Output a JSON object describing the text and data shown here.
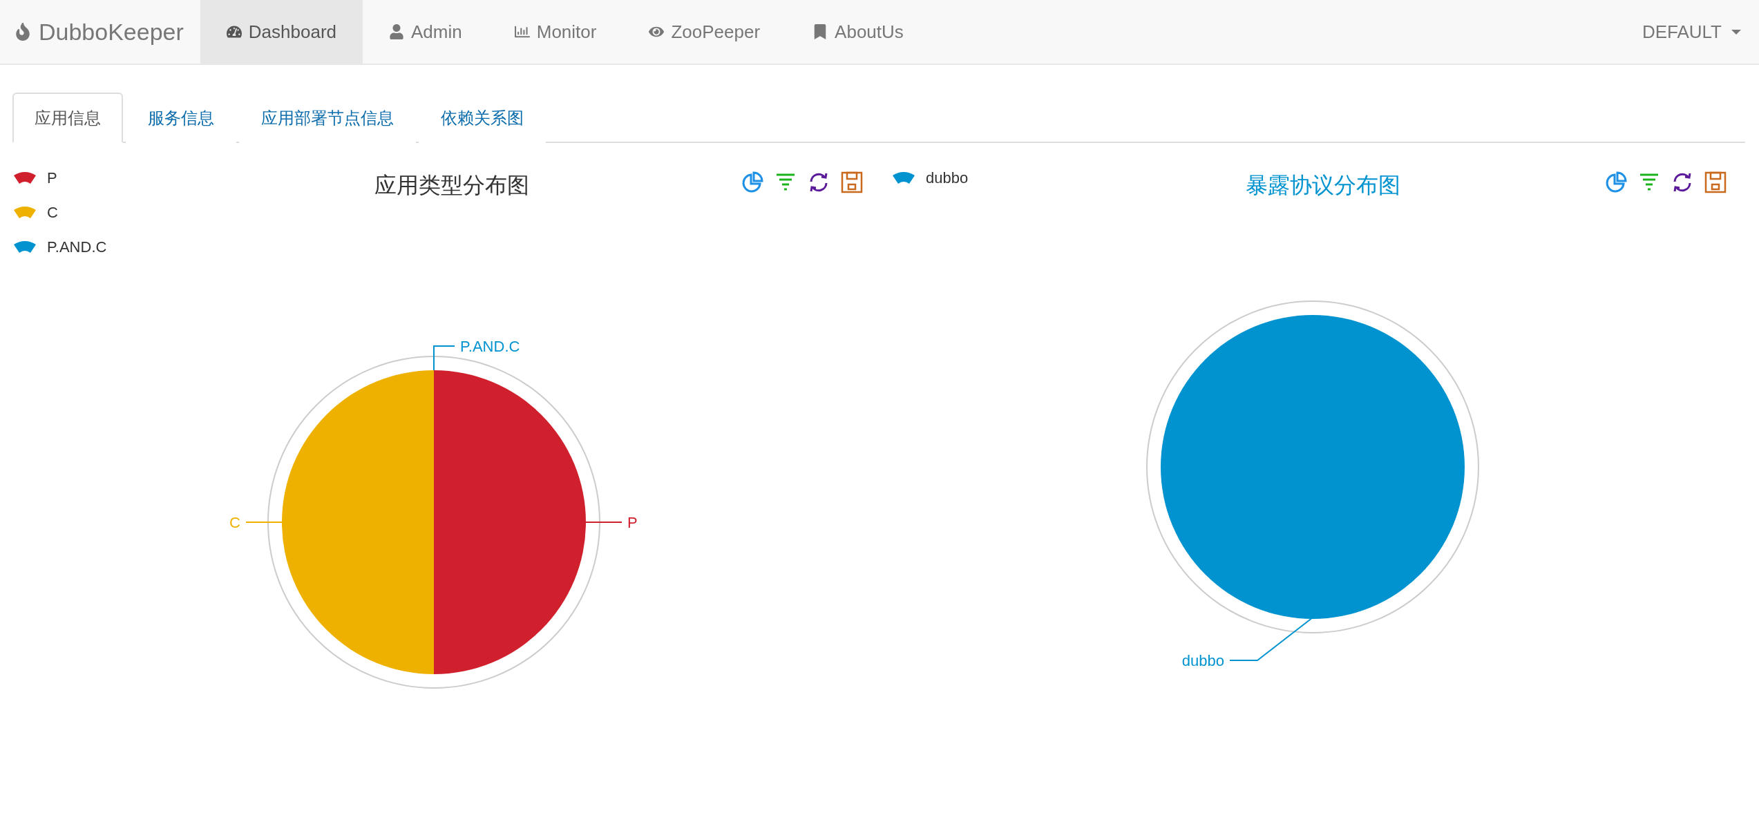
{
  "navbar": {
    "brand": "DubboKeeper",
    "items": [
      {
        "label": "Dashboard",
        "selected": true
      },
      {
        "label": "Admin",
        "selected": false
      },
      {
        "label": "Monitor",
        "selected": false
      },
      {
        "label": "ZooPeeper",
        "selected": false
      },
      {
        "label": "AboutUs",
        "selected": false
      }
    ],
    "dropdown": "DEFAULT"
  },
  "tabs": [
    {
      "label": "应用信息",
      "selected": true
    },
    {
      "label": "服务信息",
      "selected": false
    },
    {
      "label": "应用部署节点信息",
      "selected": false
    },
    {
      "label": "依赖关系图",
      "selected": false
    }
  ],
  "panels": [
    {
      "title_highlighted": false,
      "chart_data": {
        "type": "pie",
        "title": "应用类型分布图",
        "categories": [
          "P",
          "C",
          "P.AND.C"
        ],
        "values": [
          50,
          50,
          0
        ],
        "colors": [
          "#d0202e",
          "#efb100",
          "#0093d0"
        ]
      }
    },
    {
      "title_highlighted": true,
      "chart_data": {
        "type": "pie",
        "title": "暴露协议分布图",
        "categories": [
          "dubbo"
        ],
        "values": [
          100
        ],
        "colors": [
          "#0093d0"
        ]
      }
    }
  ]
}
